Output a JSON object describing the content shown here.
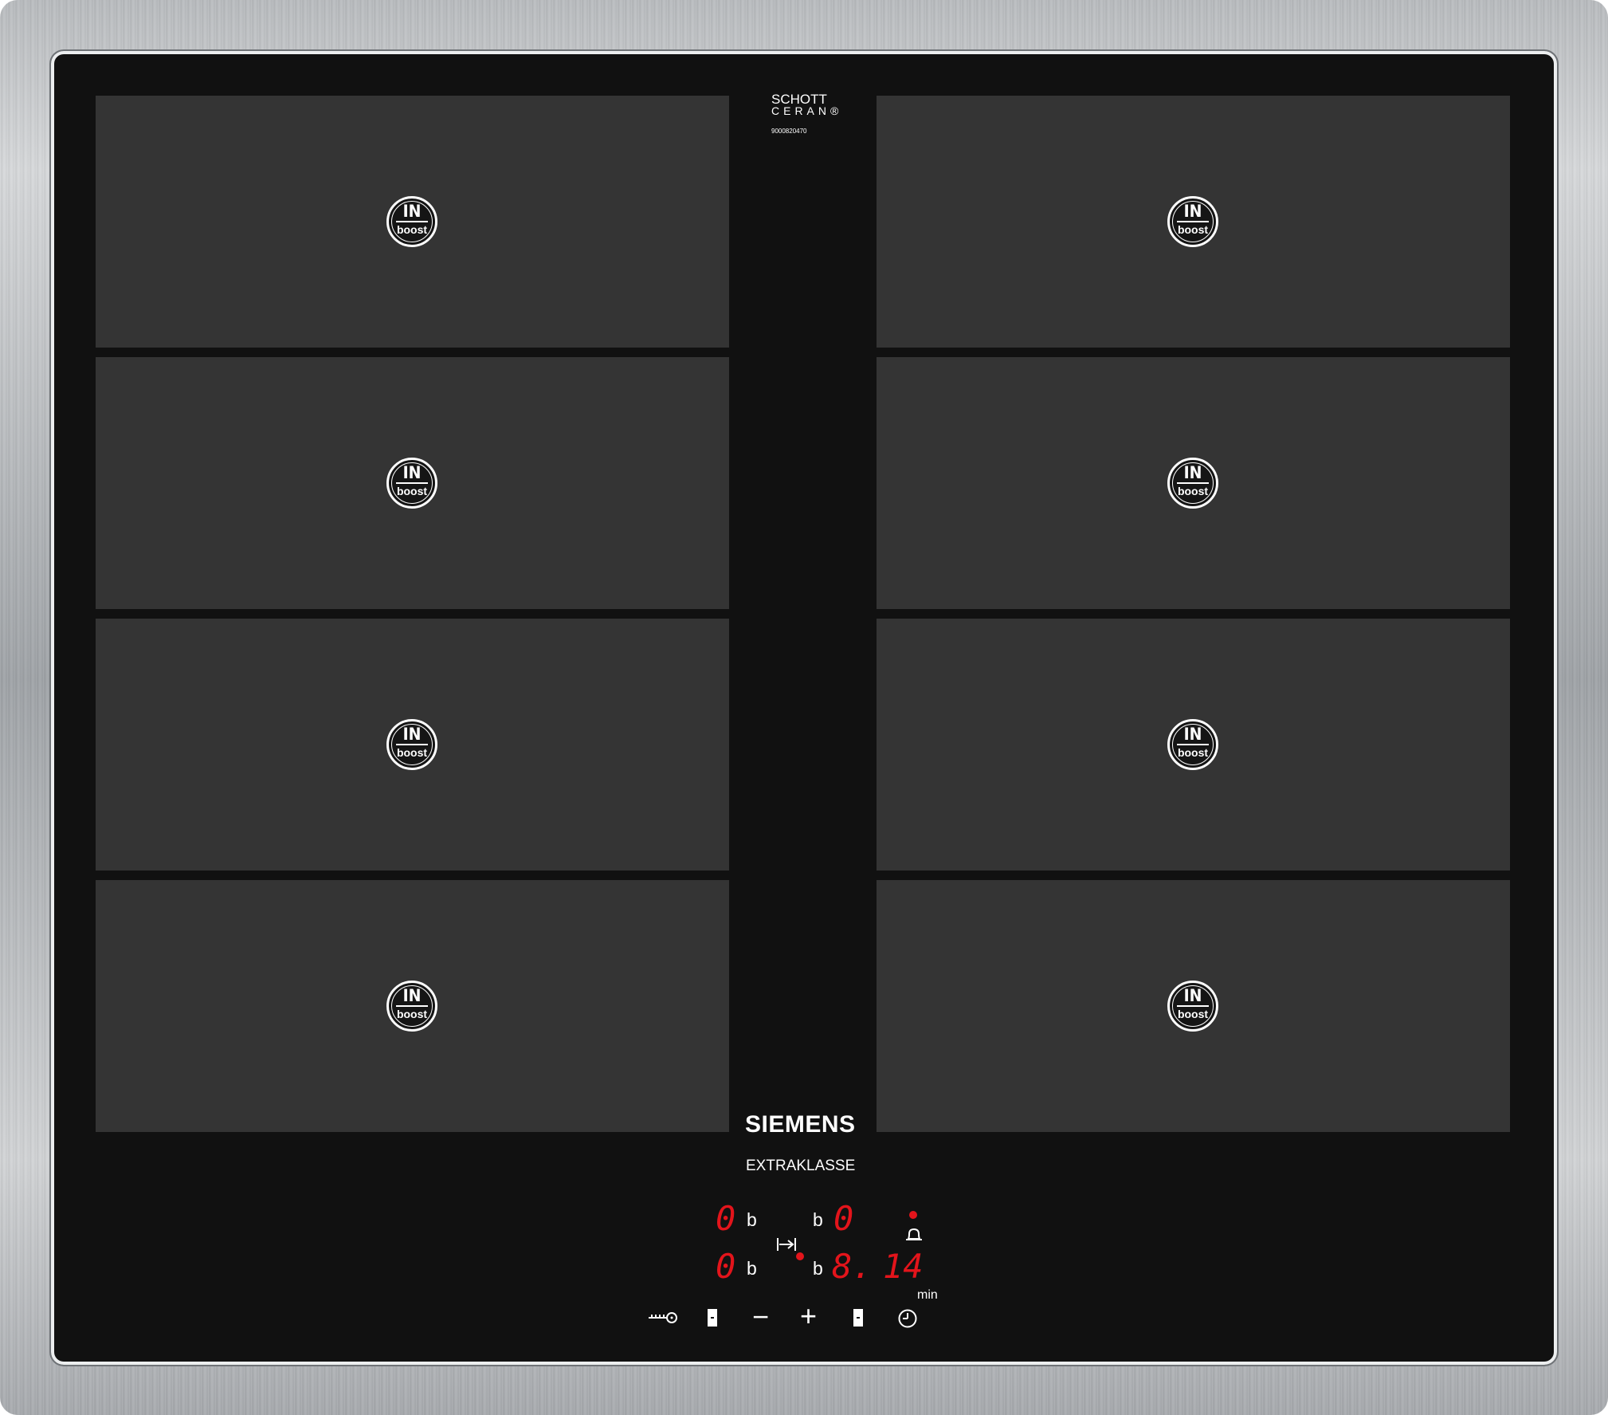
{
  "brand": {
    "glass_maker_line1": "SCHOTT",
    "glass_maker_line2": "CERAN®",
    "serial": "9000820470",
    "name": "SIEMENS",
    "series": "EXTRAKLASSE"
  },
  "zones": [
    {
      "badge_top": "IN",
      "badge_bottom": "boost"
    },
    {
      "badge_top": "IN",
      "badge_bottom": "boost"
    },
    {
      "badge_top": "IN",
      "badge_bottom": "boost"
    },
    {
      "badge_top": "IN",
      "badge_bottom": "boost"
    },
    {
      "badge_top": "IN",
      "badge_bottom": "boost"
    },
    {
      "badge_top": "IN",
      "badge_bottom": "boost"
    },
    {
      "badge_top": "IN",
      "badge_bottom": "boost"
    },
    {
      "badge_top": "IN",
      "badge_bottom": "boost"
    }
  ],
  "display": {
    "front_left_level": "0",
    "front_left_b": "b",
    "front_right_level": "0",
    "front_right_b": "b",
    "rear_left_level": "0",
    "rear_left_b": "b",
    "rear_right_level": "8.",
    "rear_right_b": "b",
    "timer_value": "14",
    "timer_unit": "min"
  },
  "controls": {
    "lock_icon": "key-icon",
    "minus_label": "−",
    "plus_label": "+",
    "timer_icon": "clock-icon",
    "bell_icon": "bell-icon",
    "flex_icon": "flex-zone-icon"
  },
  "colors": {
    "glass": "#111111",
    "zone": "#343434",
    "display_red": "#e3141b",
    "frame": "#b9bcbf"
  }
}
